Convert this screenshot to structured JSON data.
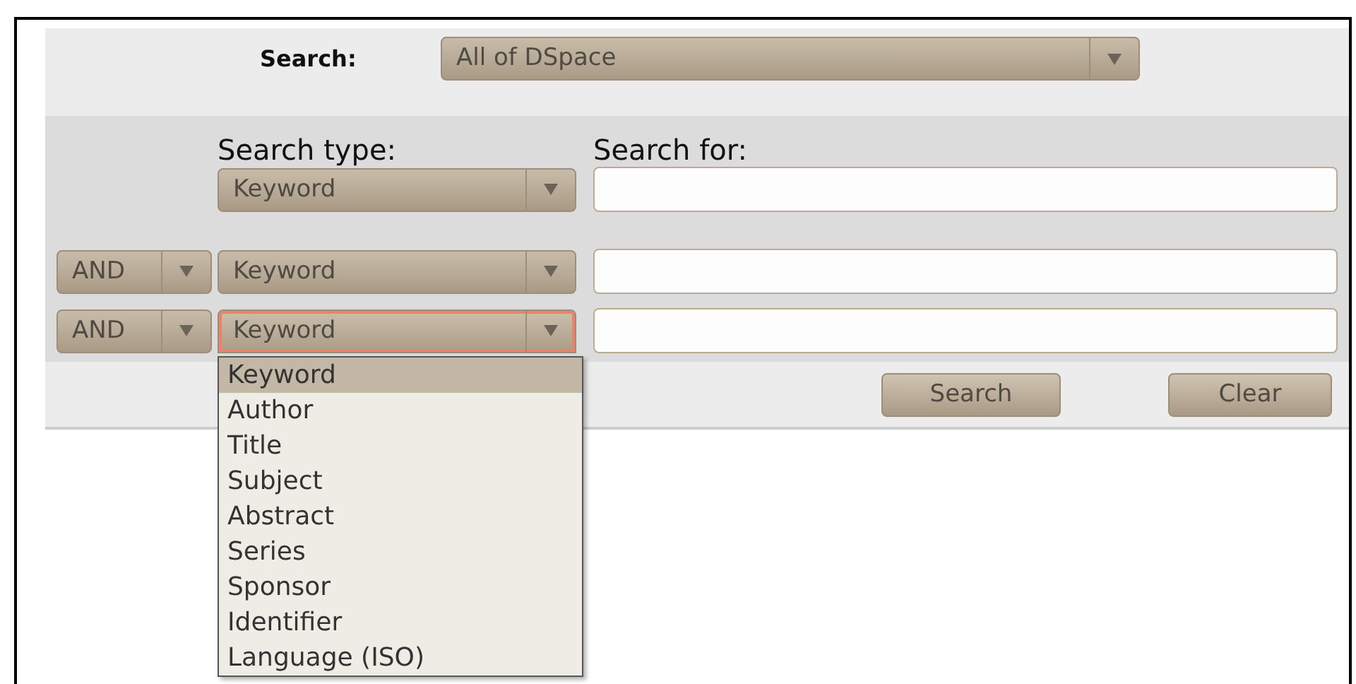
{
  "scope": {
    "label": "Search:",
    "value": "All of DSpace"
  },
  "headers": {
    "type": "Search type:",
    "query": "Search for:"
  },
  "rows": [
    {
      "type": "Keyword",
      "focused": false,
      "expanded": false
    },
    {
      "operator": "AND",
      "type": "Keyword",
      "focused": false,
      "expanded": false
    },
    {
      "operator": "AND",
      "type": "Keyword",
      "focused": true,
      "expanded": true
    }
  ],
  "dropdown": {
    "options": [
      {
        "label": "Keyword",
        "selected": true
      },
      {
        "label": "Author",
        "selected": false
      },
      {
        "label": "Title",
        "selected": false
      },
      {
        "label": "Subject",
        "selected": false
      },
      {
        "label": "Abstract",
        "selected": false
      },
      {
        "label": "Series",
        "selected": false
      },
      {
        "label": "Sponsor",
        "selected": false
      },
      {
        "label": "Identifier",
        "selected": false
      },
      {
        "label": "Language (ISO)",
        "selected": false
      }
    ]
  },
  "buttons": [
    "Search",
    "Clear"
  ]
}
